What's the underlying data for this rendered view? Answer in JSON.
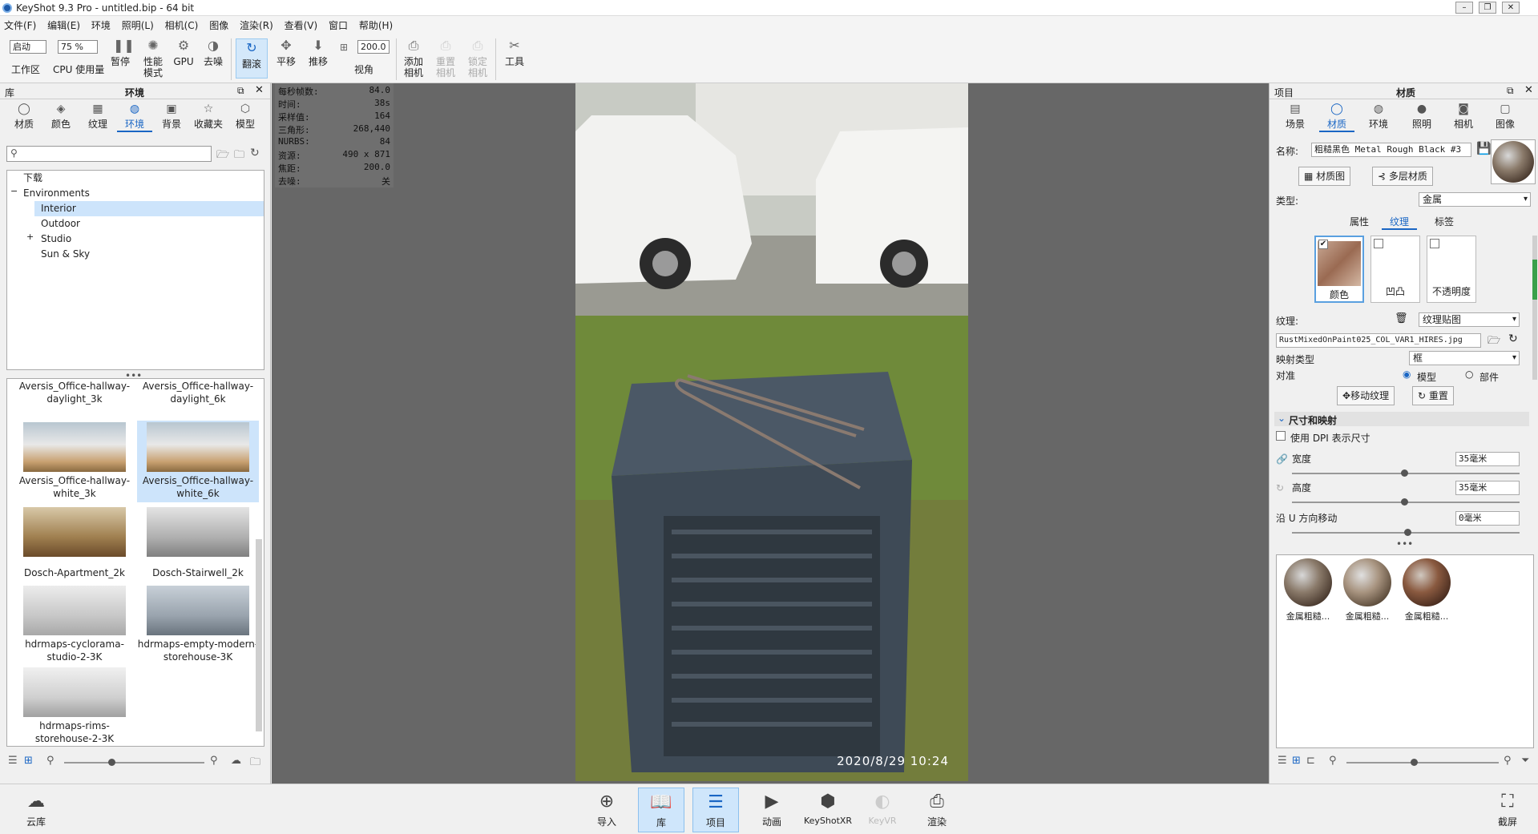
{
  "window": {
    "title": "KeyShot 9.3 Pro  - untitled.bip  - 64 bit"
  },
  "menu": [
    "文件(F)",
    "编辑(E)",
    "环境",
    "照明(L)",
    "相机(C)",
    "图像",
    "渲染(R)",
    "查看(V)",
    "窗口",
    "帮助(H)"
  ],
  "toolbar": {
    "mode_select": "启动",
    "workspace_label": "工作区",
    "cpu_select": "75 %",
    "cpu_label": "CPU 使用量",
    "pause_label": "暂停",
    "perf_label": "性能\n模式",
    "gpu_label": "GPU",
    "denoise_label": "去噪",
    "tumble_label": "翻滚",
    "pan_label": "平移",
    "dolly_label": "推移",
    "fov_value": "200.0",
    "fov_label": "视角",
    "add_camera_label": "添加\n相机",
    "reset_camera_label": "重置\n相机",
    "lock_camera_label": "锁定\n相机",
    "tools_label": "工具"
  },
  "library": {
    "header_left": "库",
    "header_title": "环境",
    "tabs": [
      {
        "label": "材质",
        "icon": "material-icon"
      },
      {
        "label": "颜色",
        "icon": "color-icon"
      },
      {
        "label": "纹理",
        "icon": "texture-icon"
      },
      {
        "label": "环境",
        "icon": "environment-icon"
      },
      {
        "label": "背景",
        "icon": "background-icon"
      },
      {
        "label": "收藏夹",
        "icon": "favorites-icon"
      },
      {
        "label": "模型",
        "icon": "model-icon"
      }
    ],
    "search_placeholder": "",
    "tree": [
      {
        "label": "下载"
      },
      {
        "label": "Environments"
      },
      {
        "label": "Interior"
      },
      {
        "label": "Outdoor"
      },
      {
        "label": "Studio"
      },
      {
        "label": "Sun & Sky"
      }
    ],
    "thumbs": [
      {
        "name": "Aversis_Office-hallway-daylight_3k"
      },
      {
        "name": "Aversis_Office-hallway-daylight_6k"
      },
      {
        "name": "Aversis_Office-hallway-white_3k"
      },
      {
        "name": "Aversis_Office-hallway-white_6k"
      },
      {
        "name": "Dosch-Apartment_2k"
      },
      {
        "name": "Dosch-Stairwell_2k"
      },
      {
        "name": "hdrmaps-cyclorama-studio-2-3K"
      },
      {
        "name": "hdrmaps-empty-modern-storehouse-3K"
      },
      {
        "name": "hdrmaps-rims-storehouse-2-3K"
      }
    ]
  },
  "stats": [
    {
      "k": "每秒帧数:",
      "v": "84.0"
    },
    {
      "k": "时间:",
      "v": "38s"
    },
    {
      "k": "采样值:",
      "v": "164"
    },
    {
      "k": "三角形:",
      "v": "268,440"
    },
    {
      "k": "NURBS:",
      "v": "84"
    },
    {
      "k": "资源:",
      "v": "490 x 871"
    },
    {
      "k": "焦距:",
      "v": "200.0"
    },
    {
      "k": "去噪:",
      "v": "关"
    }
  ],
  "viewport": {
    "timestamp": "2020/8/29  10:24"
  },
  "project": {
    "header_left": "项目",
    "header_title": "材质",
    "tabs": [
      {
        "label": "场景",
        "icon": "scene-icon"
      },
      {
        "label": "材质",
        "icon": "material-icon"
      },
      {
        "label": "环境",
        "icon": "environment-icon"
      },
      {
        "label": "照明",
        "icon": "lighting-icon"
      },
      {
        "label": "相机",
        "icon": "camera-icon"
      },
      {
        "label": "图像",
        "icon": "image-icon"
      }
    ],
    "name_label": "名称:",
    "name_value": "粗糙黑色 Metal Rough Black #3",
    "material_graph_btn": "材质图",
    "multilayer_btn": "多层材质",
    "type_label": "类型:",
    "type_value": "金属",
    "subtabs": [
      "属性",
      "纹理",
      "标签"
    ],
    "slots": [
      {
        "label": "颜色",
        "checked": true
      },
      {
        "label": "凹凸",
        "checked": false
      },
      {
        "label": "不透明度",
        "checked": false
      }
    ],
    "texture_label": "纹理:",
    "texture_value": "纹理贴图",
    "file_value": "RustMixedOnPaint025_COL_VAR1_HIRES.jpg",
    "mapping_label": "映射类型",
    "mapping_value": "框",
    "align_label": "对准",
    "align_model": "模型",
    "align_part": "部件",
    "move_texture_btn": "移动纹理",
    "reset_btn": "重置",
    "section_title": "尺寸和映射",
    "dpi_label": "使用 DPI 表示尺寸",
    "width_label": "宽度",
    "width_value": "35毫米",
    "height_label": "高度",
    "height_value": "35毫米",
    "u_shift_label": "沿 U 方向移动",
    "u_shift_value": "0毫米",
    "swatches": [
      {
        "name": "金属粗糙..."
      },
      {
        "name": "金属粗糙..."
      },
      {
        "name": "金属粗糙..."
      }
    ]
  },
  "bottom": {
    "cloud_label": "云库",
    "import_label": "导入",
    "library_label": "库",
    "project_label": "项目",
    "animation_label": "动画",
    "keyshotxr_label": "KeyShotXR",
    "keyvr_label": "KeyVR",
    "render_label": "渲染",
    "screenshot_label": "截屏"
  }
}
